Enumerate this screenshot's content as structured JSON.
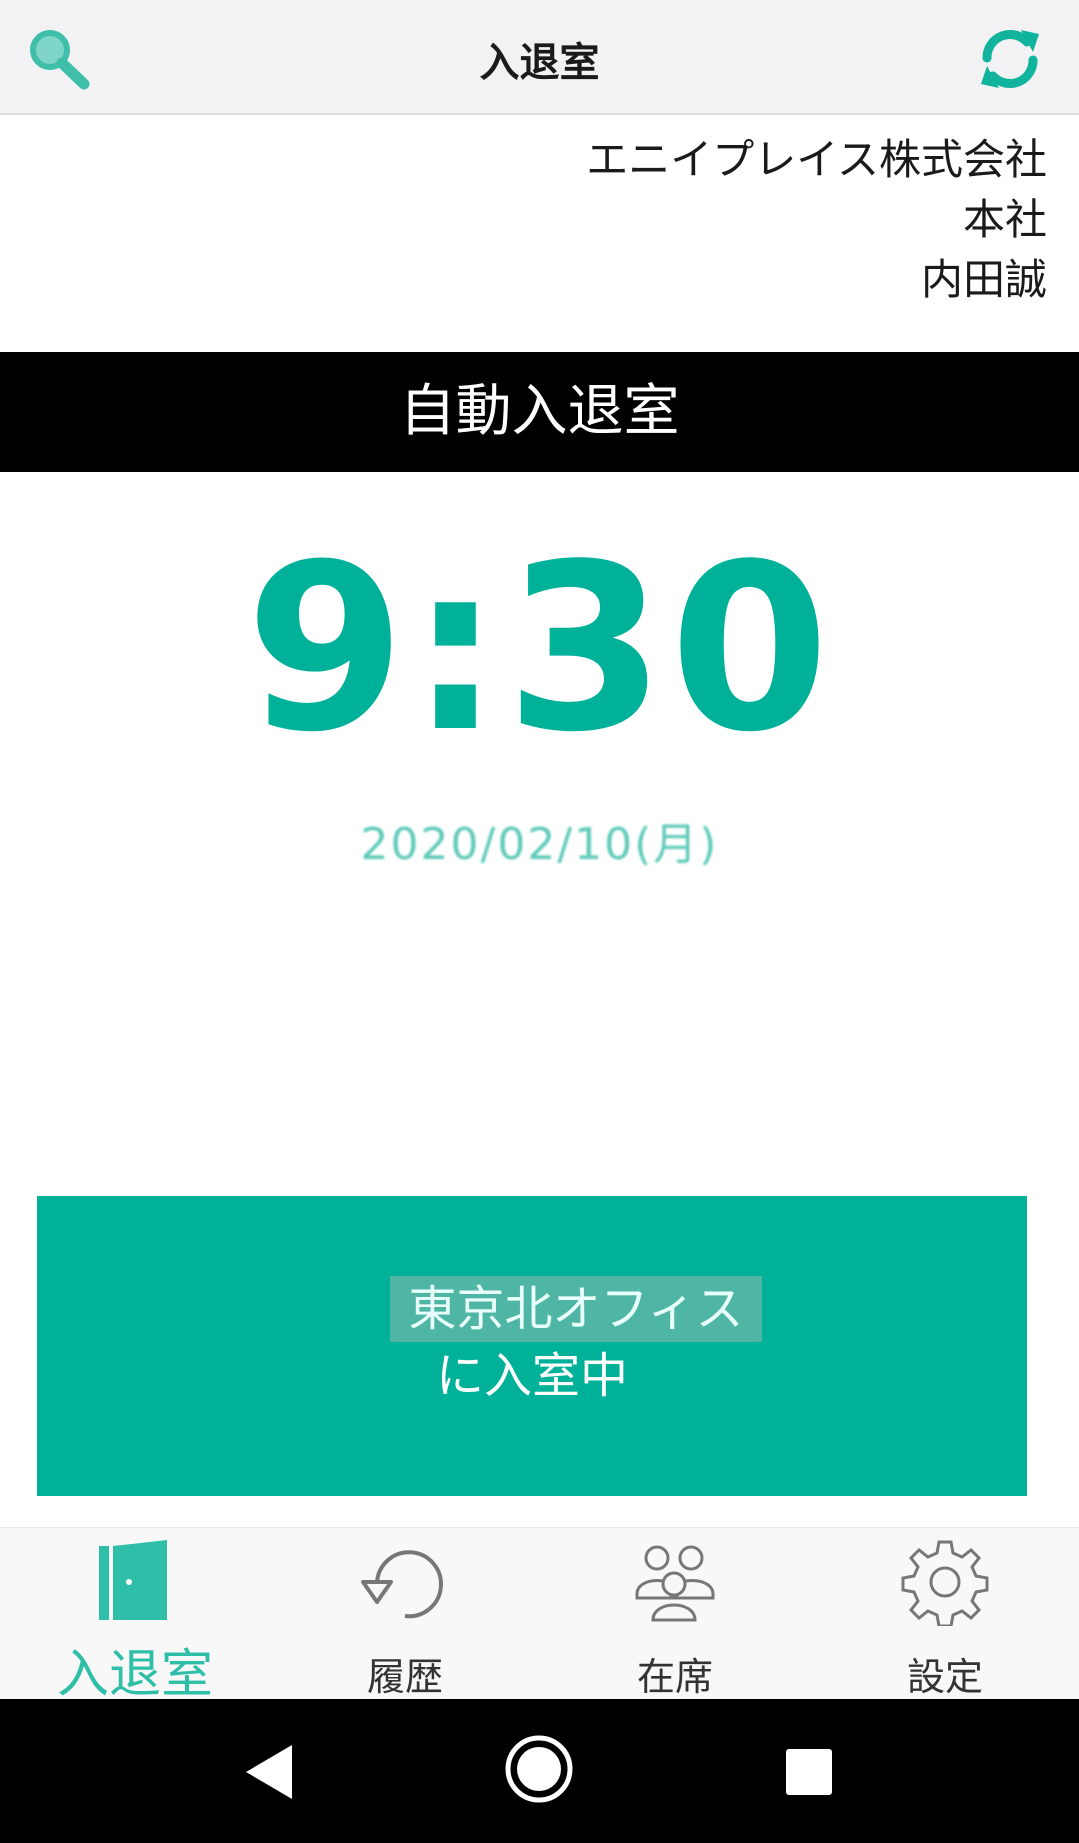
{
  "header": {
    "title": "入退室",
    "search_icon": "search-icon",
    "refresh_icon": "refresh-icon"
  },
  "user": {
    "company": "エニイプレイス株式会社",
    "branch": "本社",
    "name": "内田誠"
  },
  "mode_banner": {
    "label": "自動入退室"
  },
  "clock": {
    "time": "9:30",
    "date": "2020/02/10(月)"
  },
  "status": {
    "office": "東京北オフィス",
    "state": "に入室中"
  },
  "tabs": [
    {
      "label": "入退室",
      "icon": "door-icon",
      "active": true
    },
    {
      "label": "履歴",
      "icon": "history-icon",
      "active": false
    },
    {
      "label": "在席",
      "icon": "people-icon",
      "active": false
    },
    {
      "label": "設定",
      "icon": "gear-icon",
      "active": false
    }
  ],
  "colors": {
    "accent": "#00b19a",
    "tab_active": "#2fbfa8",
    "banner": "#000000"
  }
}
